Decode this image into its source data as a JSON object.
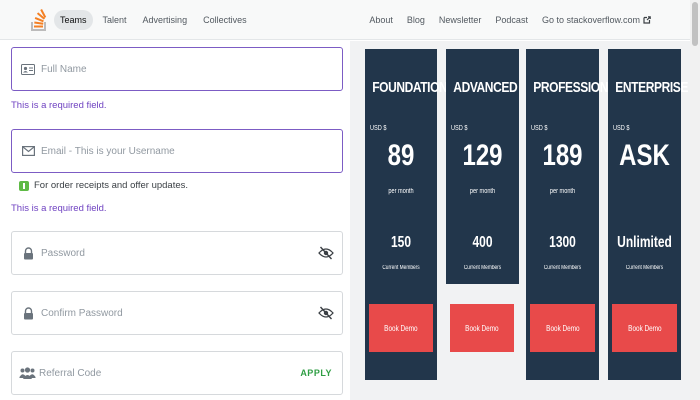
{
  "nav": {
    "logo_icon": "stackoverflow-logo-icon",
    "left": [
      "Teams",
      "Talent",
      "Advertising",
      "Collectives"
    ],
    "right": [
      "About",
      "Blog",
      "Newsletter",
      "Podcast",
      "Go to stackoverflow.com"
    ],
    "external_icon": "external-link-icon"
  },
  "form": {
    "full_name": {
      "placeholder": "Full Name",
      "icon": "id-card-icon",
      "error": "This is a required field."
    },
    "email": {
      "placeholder": "Email - This is your Username",
      "icon": "envelope-icon",
      "hint": "For order receipts and offer updates.",
      "error": "This is a required field."
    },
    "password": {
      "placeholder": "Password",
      "icon": "lock-icon",
      "toggle_icon": "eye-slash-icon"
    },
    "confirm_password": {
      "placeholder": "Confirm Password",
      "icon": "lock-icon",
      "toggle_icon": "eye-slash-icon"
    },
    "referral": {
      "placeholder": "Referral Code",
      "icon": "users-icon",
      "apply_label": "APPLY"
    }
  },
  "pricing": {
    "colors": {
      "card": "#22364b",
      "button": "#e84a4a",
      "panel": "#f1f2f3"
    },
    "plans": [
      {
        "tier": "FOUNDATION",
        "currency": "USD $",
        "price": "89",
        "per": "per month",
        "members": "150",
        "members_label": "Current Members",
        "button": "Book Demo"
      },
      {
        "tier": "ADVANCED",
        "currency": "USD $",
        "price": "129",
        "per": "per month",
        "members": "400",
        "members_label": "Current Members",
        "button": "Book Demo"
      },
      {
        "tier": "PROFESSIONAL",
        "currency": "USD $",
        "price": "189",
        "per": "per month",
        "members": "1300",
        "members_label": "Current Members",
        "button": "Book Demo"
      },
      {
        "tier": "ENTERPRISE",
        "currency": "USD $",
        "price": "ASK",
        "per": "",
        "members": "Unlimited",
        "members_label": "Current Members",
        "button": "Book Demo"
      }
    ]
  }
}
